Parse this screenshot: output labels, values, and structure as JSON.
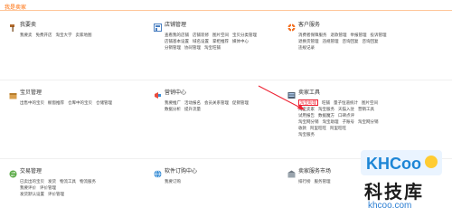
{
  "page_title": "我是卖家",
  "sections": {
    "wobai": {
      "title": "我要卖",
      "links": [
        "我要卖",
        "免费开店",
        "淘宝大学",
        "卖家地图"
      ]
    },
    "dianpu": {
      "title": "店铺管理",
      "rows": [
        [
          "查看我的店铺",
          "店铺装修",
          "图片空间",
          "宝贝分类管理"
        ],
        [
          "店铺基本设置",
          "域名设置",
          "掌柜推荐",
          "媒体中心"
        ],
        [
          "分销管理",
          "协同管理",
          "淘宝旺铺"
        ]
      ]
    },
    "kehu": {
      "title": "客户服务",
      "rows": [
        [
          "消费者保障服务",
          "退款管理",
          "举报管理",
          "投诉管理"
        ],
        [
          "退换货管理",
          "违规管理",
          "咨询回复",
          "咨询回复"
        ],
        [
          "违规记录"
        ]
      ]
    },
    "baobei": {
      "title": "宝贝管理",
      "links": [
        "出售中的宝贝",
        "橱窗推荐",
        "仓库中的宝贝",
        "仓储管理"
      ]
    },
    "yingxiao": {
      "title": "营销中心",
      "rows": [
        [
          "我要推广",
          "活动报名",
          "会员关系管理",
          "促销管理"
        ],
        [
          "数据分析",
          "提升流量"
        ]
      ]
    },
    "mai": {
      "title": "卖家工具",
      "rows": [
        [
          "淘宝助理",
          "旺铺",
          "量子恒道统计",
          "图片空间"
        ],
        [
          "淘宝卖家",
          "淘宝服务",
          "天猫入驻",
          "营销工具"
        ],
        [
          "试用报告",
          "数据魔方",
          "口碑点评"
        ],
        [
          "淘宝网分销",
          "淘宝助理",
          "子账号",
          "淘宝网分销"
        ],
        [
          "收款",
          "阿里旺旺",
          "阿里旺旺"
        ],
        [
          "淘宝服务"
        ]
      ]
    },
    "jiaoyi": {
      "title": "交易管理",
      "rows": [
        [
          "已卖出的宝贝",
          "发货",
          "物流工具",
          "物流服务"
        ],
        [
          "我要评价",
          "评价管理"
        ],
        [
          "发货默认设置",
          "评价管理"
        ]
      ]
    },
    "ruanjian": {
      "title": "软件订购中心",
      "links": [
        "我要订购"
      ]
    },
    "fuwu": {
      "title": "卖家服务市场",
      "links": [
        "排行榜",
        "服务管理"
      ]
    }
  },
  "highlighted_link": "淘宝助理",
  "watermark": {
    "logo": "KHCoo",
    "cn": "科技库",
    "url": "khcoo.com"
  },
  "colors": {
    "accent": "#ff6a00",
    "highlight": "#e23"
  }
}
